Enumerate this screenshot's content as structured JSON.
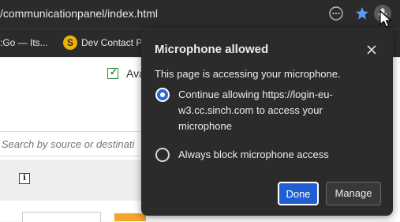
{
  "browser": {
    "url": "/communicationpanel/index.html",
    "bookmarks": [
      {
        "label": ":Go — Its..."
      },
      {
        "label": "Dev Contact Pr",
        "icon_letter": "S"
      }
    ]
  },
  "page": {
    "availability_label": "Ava",
    "search_placeholder": "Search by source or destinati",
    "info_button": "i"
  },
  "popup": {
    "title": "Microphone allowed",
    "description": "This page is accessing your microphone.",
    "option_allow_lines": [
      "Continue allowing https://login-eu-",
      "w3.cc.sinch.com to access your",
      "microphone"
    ],
    "option_allow_selected": true,
    "option_block": "Always block microphone access",
    "done_label": "Done",
    "manage_label": "Manage"
  },
  "colors": {
    "popup_bg": "#2b2b2b",
    "accent": "#1f5fd1",
    "check_green": "#2e8b3a",
    "star_blue": "#5a9cf5"
  }
}
